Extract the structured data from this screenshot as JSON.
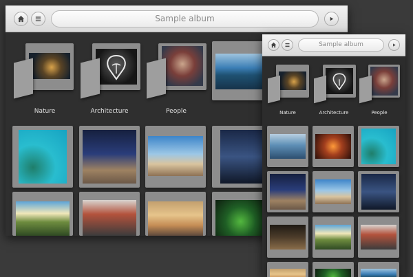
{
  "window_main": {
    "toolbar": {
      "home_icon": "home-icon",
      "menu_icon": "menu-icon",
      "search_text": "Sample album",
      "play_icon": "play-icon"
    },
    "albums": [
      {
        "label": "Nature"
      },
      {
        "label": "Architecture"
      },
      {
        "label": "People"
      }
    ]
  },
  "window_small": {
    "toolbar": {
      "home_icon": "home-icon",
      "menu_icon": "menu-icon",
      "search_text": "Sample album",
      "play_icon": "play-icon"
    },
    "albums": [
      {
        "label": "Nature"
      },
      {
        "label": "Architecture"
      },
      {
        "label": "People"
      }
    ]
  }
}
